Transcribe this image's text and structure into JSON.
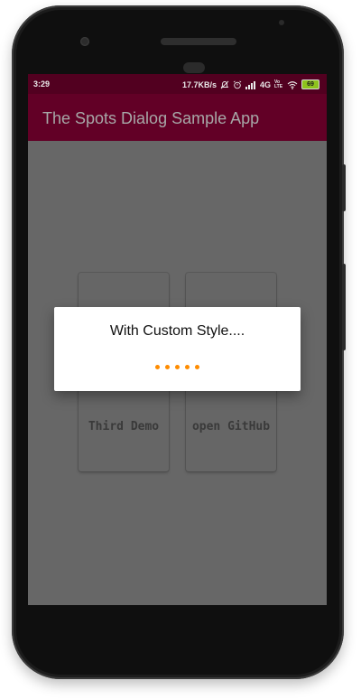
{
  "status_bar": {
    "time": "3:29",
    "speed": "17.7KB/s",
    "network": "4G",
    "volte": "Vo LTE",
    "battery": "69"
  },
  "app": {
    "title": "The Spots Dialog Sample App"
  },
  "cards": [
    {
      "label": ""
    },
    {
      "label": ""
    },
    {
      "label": "Third Demo"
    },
    {
      "label": "open GitHub"
    }
  ],
  "dialog": {
    "message": "With Custom Style....",
    "dot_color": "#ff8c00",
    "dot_count": 5
  },
  "colors": {
    "status_bar": "#520020",
    "toolbar": "#620026",
    "dim_background": "#676767"
  }
}
